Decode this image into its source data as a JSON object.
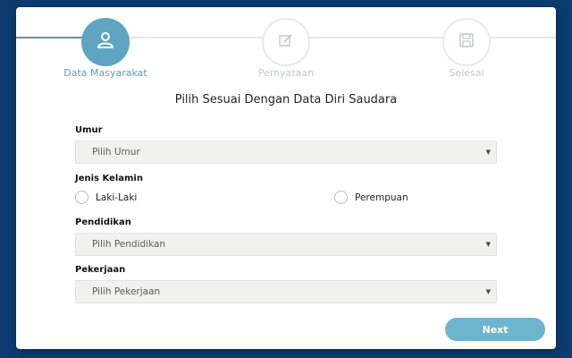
{
  "stepper": {
    "steps": [
      {
        "label": "Data Masyarakat",
        "icon": "user-icon",
        "active": true
      },
      {
        "label": "Pernyataan",
        "icon": "edit-icon",
        "active": false
      },
      {
        "label": "Selesai",
        "icon": "save-icon",
        "active": false
      }
    ]
  },
  "form": {
    "heading": "Pilih Sesuai Dengan Data Diri Saudara",
    "umur": {
      "label": "Umur",
      "value": "Pilih Umur"
    },
    "jenis_kelamin": {
      "label": "Jenis Kelamin",
      "options": [
        "Laki-Laki",
        "Perempuan"
      ]
    },
    "pendidikan": {
      "label": "Pendidikan",
      "value": "Pilih Pendidikan"
    },
    "pekerjaan": {
      "label": "Pekerjaan",
      "value": "Pilih Pekerjaan"
    },
    "dropdown_arrow": "▼"
  },
  "actions": {
    "next_label": "Next"
  },
  "colors": {
    "background": "#0d3b70",
    "accent": "#5fa4c2",
    "button": "#6fb4cd"
  }
}
